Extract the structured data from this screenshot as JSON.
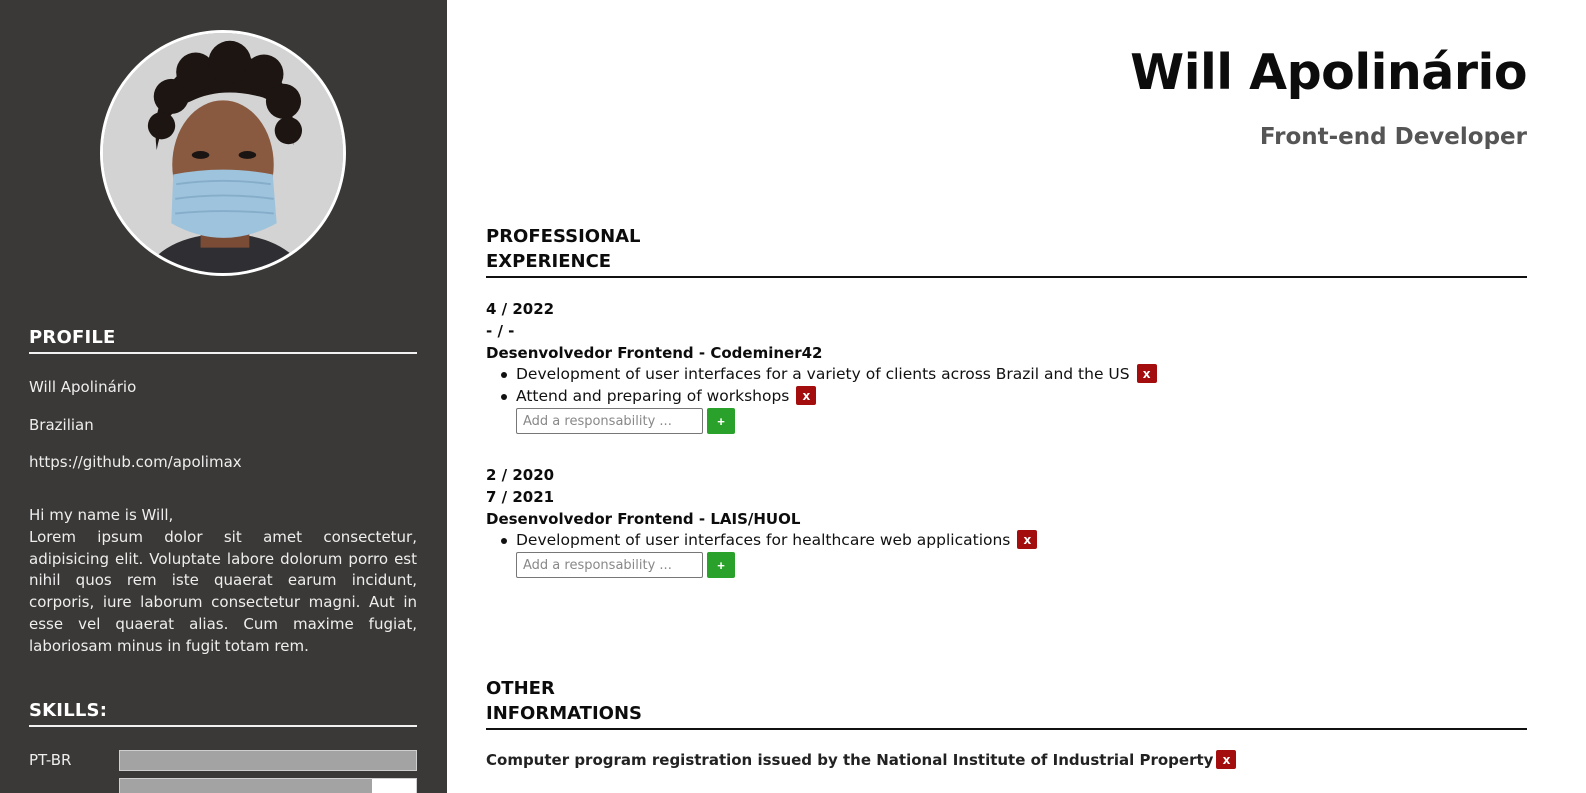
{
  "profile": {
    "name": "Will Apolinário",
    "role": "Front-end Developer",
    "photo_icon": "avatar-photo",
    "nationality": "Brazilian",
    "github": "https://github.com/apolimax",
    "bio_greeting": "Hi my name is Will,",
    "bio_text": "Lorem ipsum dolor sit amet consectetur, adipisicing elit. Voluptate labore dolorum porro est nihil quos rem iste quaerat earum incidunt, corporis, iure laborum consectetur magni. Aut in esse vel quaerat alias. Cum maxime fugiat, laboriosam minus in fugit totam rem."
  },
  "sidebar": {
    "profile_heading": "PROFILE",
    "skills_heading": "SKILLS:",
    "skills": [
      {
        "name": "PT-BR",
        "level": 1.0
      },
      {
        "name": "",
        "level": 0.85
      }
    ]
  },
  "experience": {
    "heading_line1": "PROFESSIONAL",
    "heading_line2": "EXPERIENCE",
    "jobs": [
      {
        "start": "4 / 2022",
        "end": "- / -",
        "title": "Desenvolvedor Frontend - Codeminer42",
        "responsibilities": [
          "Development of user interfaces for a variety of clients across Brazil and the US",
          "Attend and preparing of workshops"
        ]
      },
      {
        "start": "2 / 2020",
        "end": "7 / 2021",
        "title": "Desenvolvedor Frontend - LAIS/HUOL",
        "responsibilities": [
          "Development of user interfaces for healthcare web applications"
        ]
      }
    ],
    "add_placeholder": "Add a responsability ...",
    "add_label": "+",
    "remove_label": "x"
  },
  "other": {
    "heading_line1": "OTHER",
    "heading_line2": "INFORMATIONS",
    "items": [
      "Computer program registration issued by the National Institute of Industrial Property"
    ]
  },
  "colors": {
    "sidebar_bg": "#3a3937",
    "remove_button": "#a30d0d",
    "add_button": "#2aa12a",
    "skill_fill": "#a3a3a3"
  }
}
